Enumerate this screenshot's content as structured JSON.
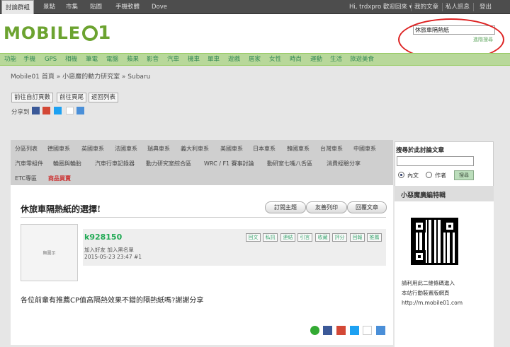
{
  "topbar": {
    "tabs": [
      "討論群組",
      "景點",
      "市集",
      "貼圖",
      "手機軟體",
      "Dove"
    ],
    "user_greeting": "Hi, trdxpro 歡迎回來 ▾",
    "links": [
      "我的文章",
      "私人訊息",
      "登出"
    ]
  },
  "header": {
    "logo_text": "MOBILE",
    "logo_suffix": "1",
    "search_value": "休旅車隔熱紙",
    "advanced_search": "進階搜尋"
  },
  "categories": [
    "功能",
    "手機",
    "GPS",
    "相機",
    "筆電",
    "電腦",
    "蘋果",
    "影音",
    "汽車",
    "機車",
    "單車",
    "遊戲",
    "居家",
    "女性",
    "時尚",
    "運動",
    "生活",
    "旅遊美食"
  ],
  "breadcrumb": "Mobile01 首頁 » 小惡魔的動力研究室 » Subaru",
  "page_buttons": [
    "前往自訂頁數",
    "前往頁尾",
    "返回列表"
  ],
  "share_label": "分享到",
  "subnav": {
    "row1": [
      "分區列表",
      "德國車系",
      "英國車系",
      "法國車系",
      "瑞典車系",
      "義大利車系",
      "美國車系",
      "日本車系",
      "韓國車系",
      "台灣車系",
      "中國車系"
    ],
    "row2": [
      "汽車零組件",
      "輪圈與輪胎",
      "汽車行車記錄器",
      "動力研究室綜合區",
      "WRC / F1 賽事討論",
      "動研室七嘴八舌區",
      "消費經驗分享"
    ],
    "row3": [
      "ETC專區",
      "商品買賣"
    ]
  },
  "post": {
    "title": "休旅車隔熱紙的選擇!",
    "title_buttons": [
      "訂閱主題",
      "友善列印",
      "回覆文章"
    ],
    "avatar_text": "無圖示",
    "username": "k928150",
    "user_links": "加入好友  加入黑名單",
    "date": "2015-05-23 23:47  #1",
    "tools": [
      "回文",
      "私訊",
      "連結",
      "引言",
      "收藏",
      "評分",
      "回報",
      "推薦"
    ],
    "body": "各位前輩有推薦CP值高隔熱效果不錯的隔熱紙嗎?謝謝分享"
  },
  "sidebar": {
    "search_title": "搜尋於此討論文章",
    "radio_content": "內文",
    "radio_author": "作者",
    "search_button": "搜尋",
    "card_title": "小惡魔廣編特輯",
    "card_text1": "請利用此二維條碼進入",
    "card_text2": "本站行動裝置版網頁",
    "card_url": "http://m.mobile01.com"
  },
  "colors": {
    "brand_green": "#6ca330",
    "category_bar": "#b8d89a",
    "highlight_red": "#dd2222"
  }
}
